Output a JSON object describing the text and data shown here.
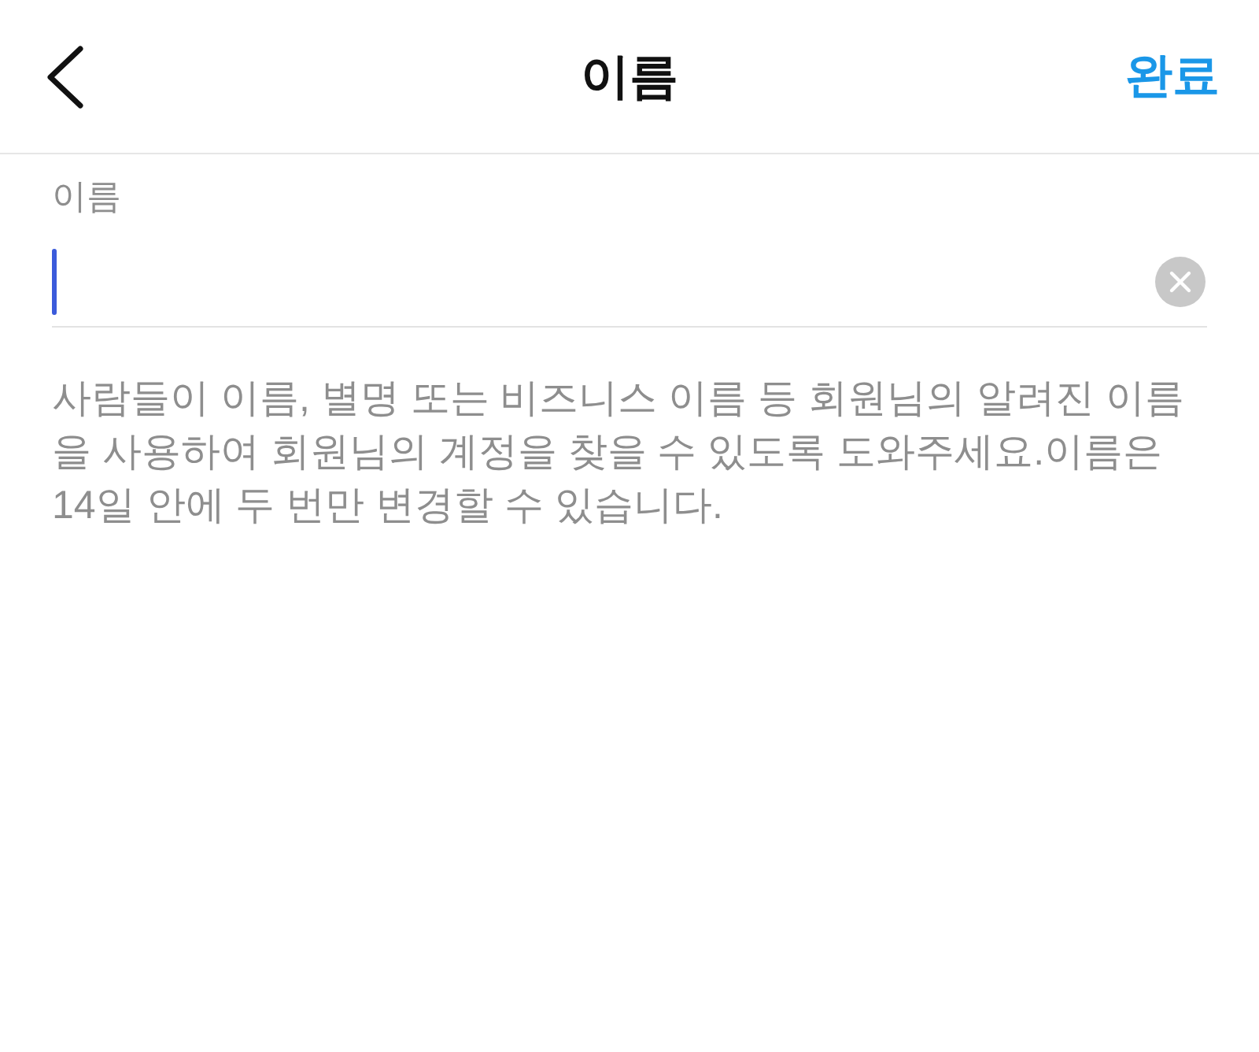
{
  "header": {
    "title": "이름",
    "done_label": "완료"
  },
  "name_field": {
    "label": "이름",
    "focused": true,
    "clear_button": true
  },
  "help_text": "사람들이 이름, 별명 또는 비즈니스 이름 등 회원님의 알려진 이름을 사용하여 회원님의 계정을 찾을 수 있도록 도와주세요.이름은 14일 안에 두 번만 변경할 수 있습니다."
}
